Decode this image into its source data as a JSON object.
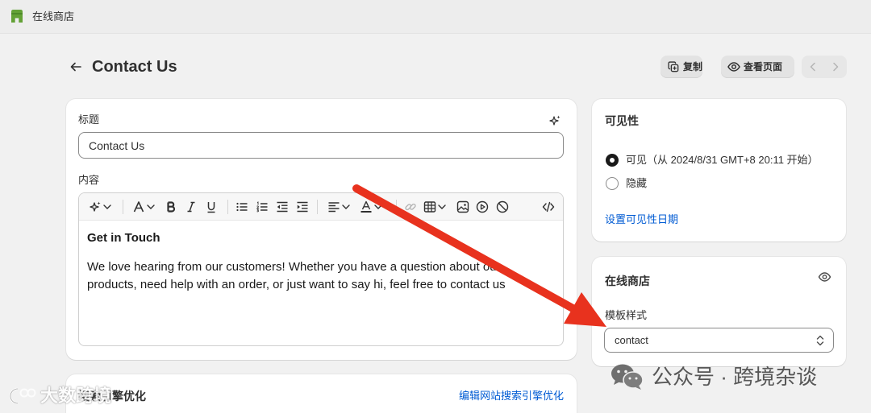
{
  "topbar": {
    "store_label": "在线商店",
    "logo_icon": "online-store-logo-icon"
  },
  "header": {
    "back_icon": "arrow-left-icon",
    "title": "Contact Us",
    "duplicate_label": "复制",
    "duplicate_icon": "duplicate-icon",
    "view_page_label": "查看页面",
    "view_page_icon": "eye-icon",
    "prev_icon": "chevron-left-icon",
    "next_icon": "chevron-right-icon"
  },
  "main": {
    "title_field": {
      "label": "标题",
      "value": "Contact Us",
      "ai_icon": "sparkle-icon"
    },
    "content_field": {
      "label": "内容",
      "toolbar_icons": [
        "sparkle-icon",
        "chevron-down-icon",
        "font-style-icon",
        "bold-icon",
        "italic-icon",
        "underline-icon",
        "bullet-list-icon",
        "numbered-list-icon",
        "outdent-icon",
        "indent-icon",
        "align-left-icon",
        "text-color-icon",
        "link-icon",
        "table-icon",
        "image-icon",
        "video-icon",
        "block-icon",
        "code-icon"
      ],
      "heading": "Get in Touch",
      "paragraph": "We love hearing from our customers! Whether you have a question about our products, need help with an order, or just want to say hi, feel free to contact us"
    },
    "seo_card": {
      "title": "搜索引擎优化",
      "edit_link": "编辑网站搜索引擎优化"
    }
  },
  "sidebar": {
    "visibility": {
      "title": "可见性",
      "options": [
        {
          "label": "可见（从 2024/8/31 GMT+8 20:11 开始）",
          "selected": true
        },
        {
          "label": "隐藏",
          "selected": false
        }
      ],
      "set_date_link": "设置可见性日期"
    },
    "online_store": {
      "title": "在线商店",
      "eye_icon": "eye-icon",
      "template_label": "模板样式",
      "template_value": "contact",
      "select_icon": "select-chevrons-icon"
    }
  },
  "watermarks": {
    "wechat_icon": "wechat-icon",
    "wechat_text": "公众号 · 跨境杂谈",
    "corner_text": "大数跨境"
  },
  "colors": {
    "page_bg": "#f1f1f1",
    "card_bg": "#ffffff",
    "text": "#303030",
    "link": "#005bd3",
    "logo_green": "#63a136",
    "annotation_arrow": "#e8321e",
    "watermark": "#4a4a4a"
  }
}
